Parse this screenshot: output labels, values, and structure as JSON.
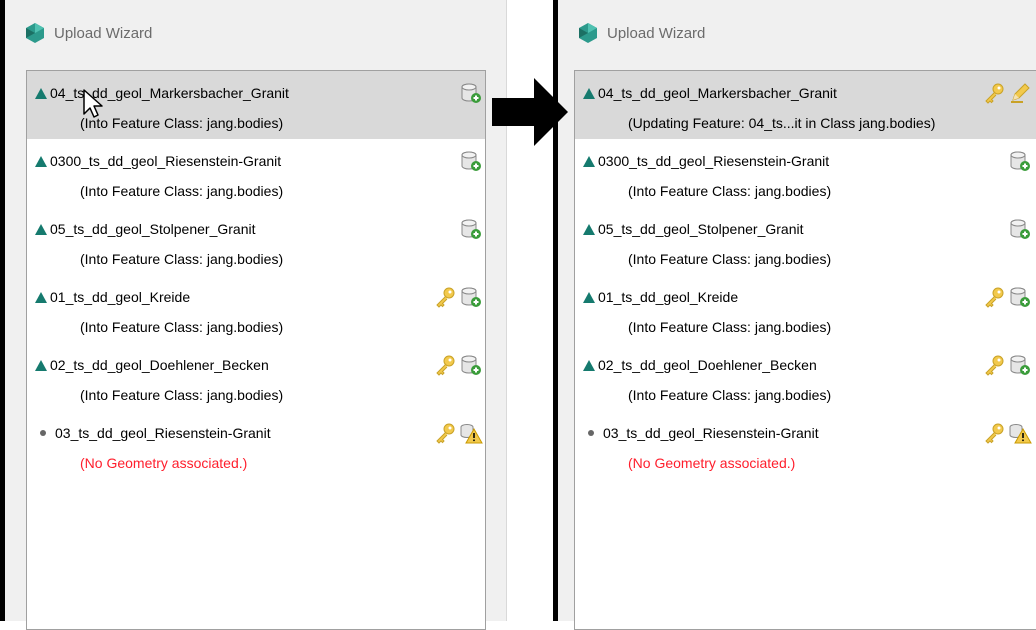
{
  "left": {
    "title": "Upload Wizard",
    "items": [
      {
        "name": "04_ts_dd_geol_Markersbacher_Granit",
        "sub": "(Into Feature Class: jang.bodies)",
        "status": "ok",
        "selected": true,
        "icons": [
          "db-add"
        ]
      },
      {
        "name": "0300_ts_dd_geol_Riesenstein-Granit",
        "sub": "(Into Feature Class: jang.bodies)",
        "status": "ok",
        "icons": [
          "db-add"
        ]
      },
      {
        "name": "05_ts_dd_geol_Stolpener_Granit",
        "sub": "(Into Feature Class: jang.bodies)",
        "status": "ok",
        "icons": [
          "db-add"
        ]
      },
      {
        "name": "01_ts_dd_geol_Kreide",
        "sub": "(Into Feature Class: jang.bodies)",
        "status": "ok",
        "icons": [
          "key",
          "db-add"
        ]
      },
      {
        "name": "02_ts_dd_geol_Doehlener_Becken",
        "sub": "(Into Feature Class: jang.bodies)",
        "status": "ok",
        "icons": [
          "key",
          "db-add"
        ]
      },
      {
        "name": "03_ts_dd_geol_Riesenstein-Granit",
        "sub": "(No Geometry associated.)",
        "status": "none",
        "error": true,
        "icons": [
          "key",
          "warn"
        ]
      }
    ]
  },
  "right": {
    "title": "Upload Wizard",
    "items": [
      {
        "name": "04_ts_dd_geol_Markersbacher_Granit",
        "sub": "(Updating Feature: 04_ts...it in Class jang.bodies)",
        "status": "ok",
        "selected": true,
        "icons": [
          "key",
          "pencil"
        ]
      },
      {
        "name": "0300_ts_dd_geol_Riesenstein-Granit",
        "sub": "(Into Feature Class: jang.bodies)",
        "status": "ok",
        "icons": [
          "db-add"
        ]
      },
      {
        "name": "05_ts_dd_geol_Stolpener_Granit",
        "sub": "(Into Feature Class: jang.bodies)",
        "status": "ok",
        "icons": [
          "db-add"
        ]
      },
      {
        "name": "01_ts_dd_geol_Kreide",
        "sub": "(Into Feature Class: jang.bodies)",
        "status": "ok",
        "icons": [
          "key",
          "db-add"
        ]
      },
      {
        "name": "02_ts_dd_geol_Doehlener_Becken",
        "sub": "(Into Feature Class: jang.bodies)",
        "status": "ok",
        "icons": [
          "key",
          "db-add"
        ]
      },
      {
        "name": "03_ts_dd_geol_Riesenstein-Granit",
        "sub": "(No Geometry associated.)",
        "status": "none",
        "error": true,
        "icons": [
          "key",
          "warn"
        ]
      }
    ]
  },
  "colors": {
    "accent": "#157a6e",
    "error": "#ff1e2c",
    "selected": "#d9d9d9"
  }
}
